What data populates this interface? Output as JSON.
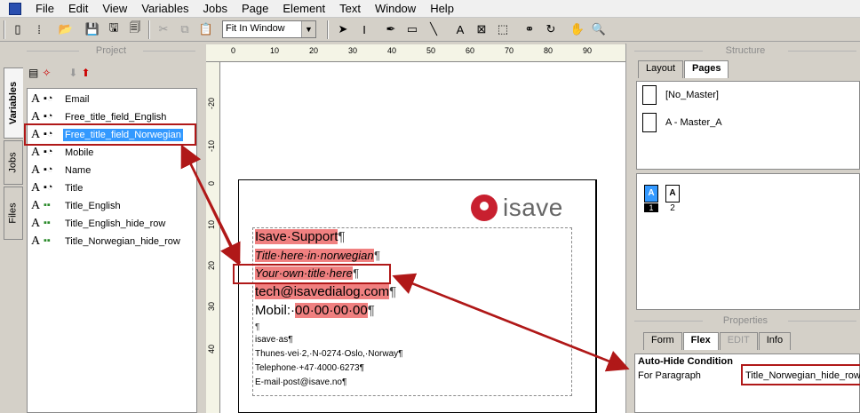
{
  "menu": [
    "File",
    "Edit",
    "View",
    "Variables",
    "Jobs",
    "Page",
    "Element",
    "Text",
    "Window",
    "Help"
  ],
  "toolbar": {
    "zoom_value": "Fit In Window"
  },
  "vertical_tabs": [
    "Variables",
    "Jobs",
    "Files"
  ],
  "project": {
    "title": "Project",
    "variables": [
      {
        "label": "Email",
        "type": "text"
      },
      {
        "label": "Free_title_field_English",
        "type": "text"
      },
      {
        "label": "Free_title_field_Norwegian",
        "type": "text",
        "selected": true
      },
      {
        "label": "Mobile",
        "type": "text"
      },
      {
        "label": "Name",
        "type": "text"
      },
      {
        "label": "Title",
        "type": "text"
      },
      {
        "label": "Title_English",
        "type": "condition"
      },
      {
        "label": "Title_English_hide_row",
        "type": "condition"
      },
      {
        "label": "Title_Norwegian_hide_row",
        "type": "condition"
      }
    ]
  },
  "ruler": {
    "top": [
      "0",
      "10",
      "20",
      "30",
      "40",
      "50",
      "60",
      "70",
      "80",
      "90"
    ],
    "left": [
      "-20",
      "-10",
      "0",
      "10",
      "20",
      "30",
      "40"
    ]
  },
  "document": {
    "logo_text": "isave",
    "lines": [
      {
        "text": "Isave·Support",
        "pilcrow": "¶"
      },
      {
        "text": "Title·here·in·norwegian",
        "pilcrow": "¶"
      },
      {
        "text": "Your·own·title·here",
        "pilcrow": "¶"
      },
      {
        "text": "tech@isavedialog.com",
        "pilcrow": "¶"
      },
      {
        "prefix": "Mobil:·",
        "text": "00·00·00·00",
        "pilcrow": "¶"
      },
      {
        "text": "¶"
      },
      {
        "text": "isave·as¶"
      },
      {
        "text": "Thunes·vei·2,·N-0274·Oslo,·Norway¶"
      },
      {
        "text": "Telephone·+47·4000·6273¶"
      },
      {
        "text": "E-mail·post@isave.no¶"
      }
    ]
  },
  "structure": {
    "title": "Structure",
    "tabs": [
      "Layout",
      "Pages"
    ],
    "masters": [
      "[No_Master]",
      "A - Master_A"
    ],
    "pages": [
      {
        "letter": "A",
        "number": "1"
      },
      {
        "letter": "A",
        "number": "2"
      }
    ]
  },
  "properties": {
    "title": "Properties",
    "tabs": [
      "Form",
      "Flex",
      "EDIT",
      "Info"
    ],
    "heading": "Auto-Hide Condition",
    "row_label": "For Paragraph",
    "row_value": "Title_Norwegian_hide_row"
  }
}
